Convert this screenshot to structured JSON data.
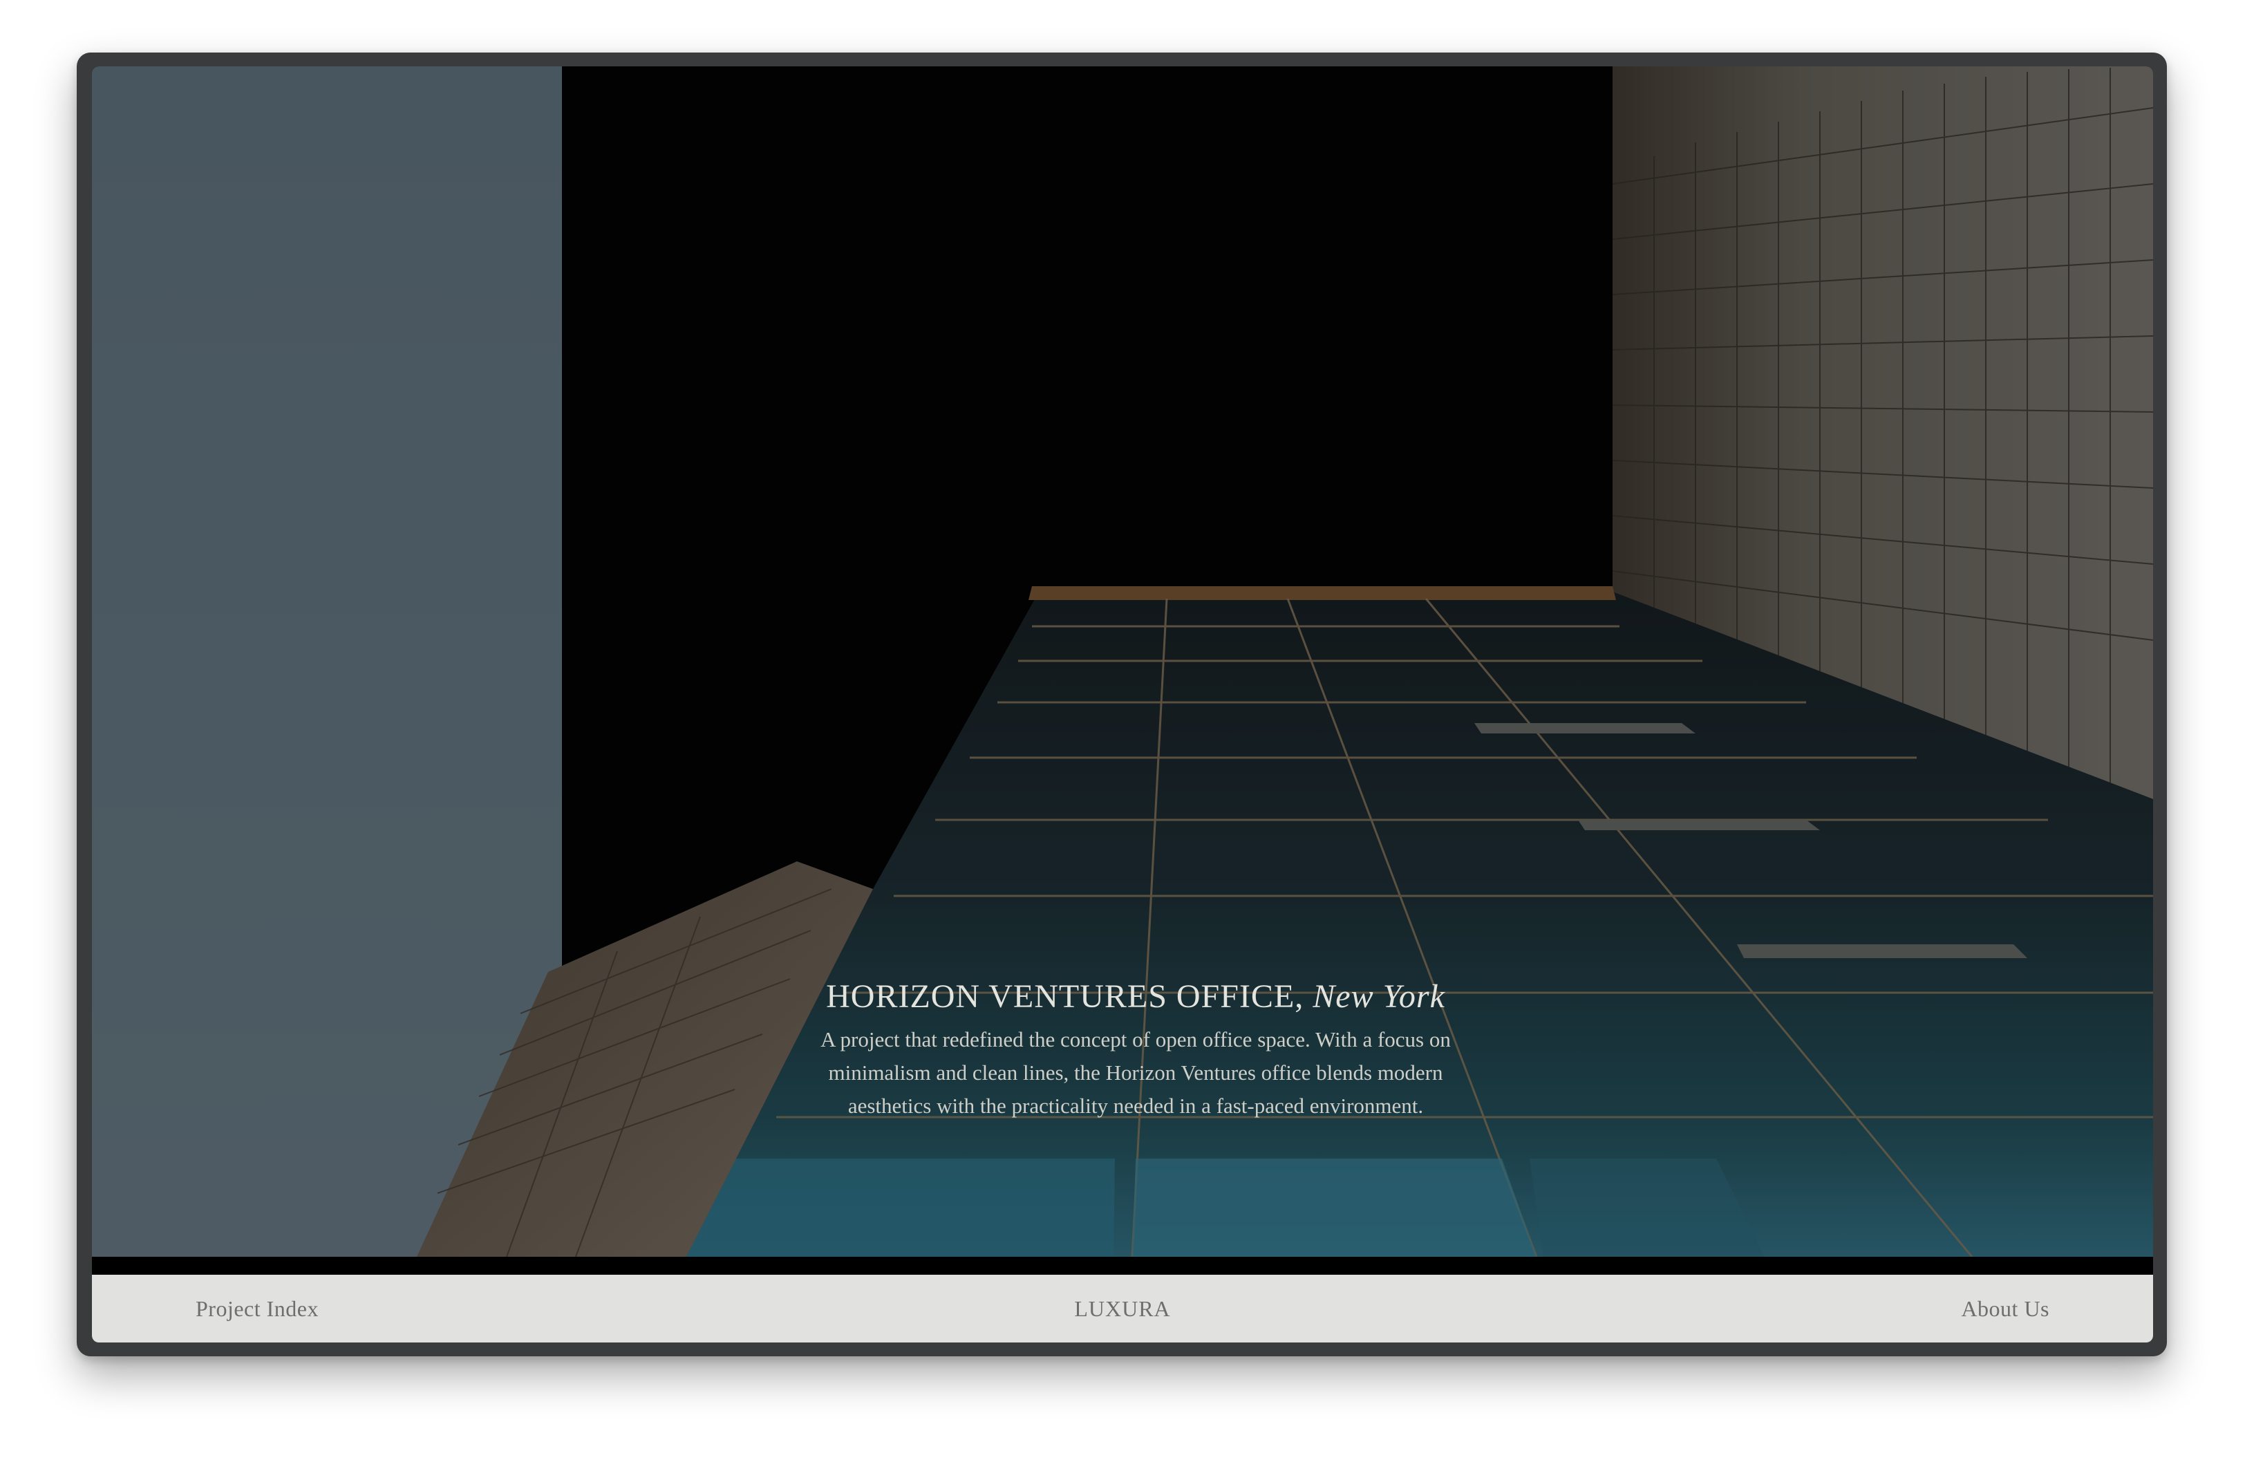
{
  "hero": {
    "title": "HORIZON VENTURES OFFICE,",
    "city": "New York",
    "description": "A project that redefined the concept of open office space. With a focus on minimalism and clean lines, the Horizon Ventures office blends modern aesthetics with the practicality needed in a fast-paced environment."
  },
  "footer": {
    "left_link": "Project Index",
    "brand": "LUXURA",
    "right_link": "About Us"
  },
  "colors": {
    "sky": "#5d6d78",
    "footer_bg": "#e1e2df",
    "footer_text": "#6e6f6d",
    "caption_text": "#e4e4de"
  }
}
